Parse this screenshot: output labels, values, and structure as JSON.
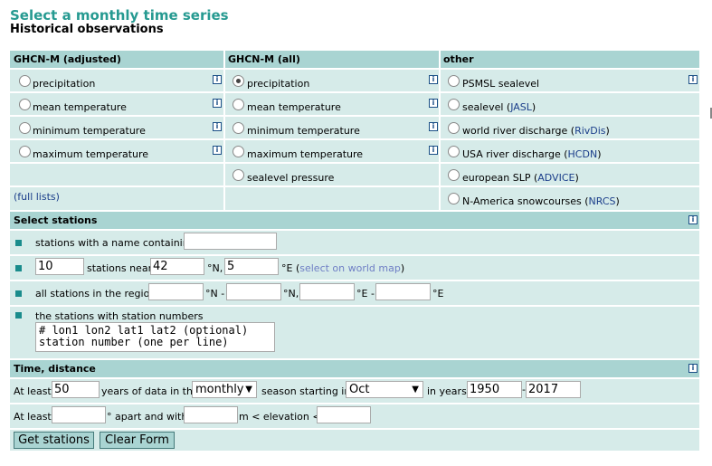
{
  "page": {
    "title": "Select a monthly time series",
    "subtitle": "Historical observations"
  },
  "series": {
    "col1_header": "GHCN-M (adjusted)",
    "col2_header": "GHCN-M (all)",
    "col3_header": "other",
    "col1": [
      "precipitation",
      "mean temperature",
      "minimum temperature",
      "maximum temperature"
    ],
    "col2": [
      "precipitation",
      "mean temperature",
      "minimum temperature",
      "maximum temperature",
      "sealevel pressure"
    ],
    "col3": [
      {
        "text": "PSMSL sealevel",
        "link": ""
      },
      {
        "text": "sealevel (",
        "link": "JASL",
        "tail": ")"
      },
      {
        "text": "world river discharge (",
        "link": "RivDis",
        "tail": ")"
      },
      {
        "text": "USA river discharge (",
        "link": "HCDN",
        "tail": ")"
      },
      {
        "text": "european SLP (",
        "link": "ADVICE",
        "tail": ")"
      },
      {
        "text": "N-America snowcourses (",
        "link": "NRCS",
        "tail": ")"
      }
    ],
    "full_lists": "(full lists)",
    "selected": "GHCN-M (all) precipitation"
  },
  "stations": {
    "header": "Select stations",
    "name_label": "stations with a name containing",
    "name_value": "",
    "n_value": "10",
    "near_label": "stations near",
    "lat_value": "42",
    "n_unit": "°N,",
    "lon_value": "5",
    "e_unit": "°E",
    "map_link": "select on world map",
    "region_label": "all stations in the region",
    "region_n1": "°N -",
    "region_n2": "°N,",
    "region_e1": "°E -",
    "region_e2": "°E",
    "numbers_label": "the stations with station numbers",
    "numbers_text": "# lon1 lon2 lat1 lat2 (optional)\nstation number (one per line)"
  },
  "time": {
    "header": "Time, distance",
    "atleast": "At least",
    "years_value": "50",
    "years_label": "years of data in the",
    "period_value": "monthly",
    "season_label": "season starting in",
    "month_value": "Oct",
    "in_years": "in years",
    "year_from": "1950",
    "dash": "-",
    "year_to": "2017",
    "atleast2": "At least",
    "apart_label": "° apart and with",
    "elev_label": "m < elevation <"
  },
  "buttons": {
    "get": "Get stations",
    "clear": "Clear Form"
  },
  "info_glyph": "i"
}
